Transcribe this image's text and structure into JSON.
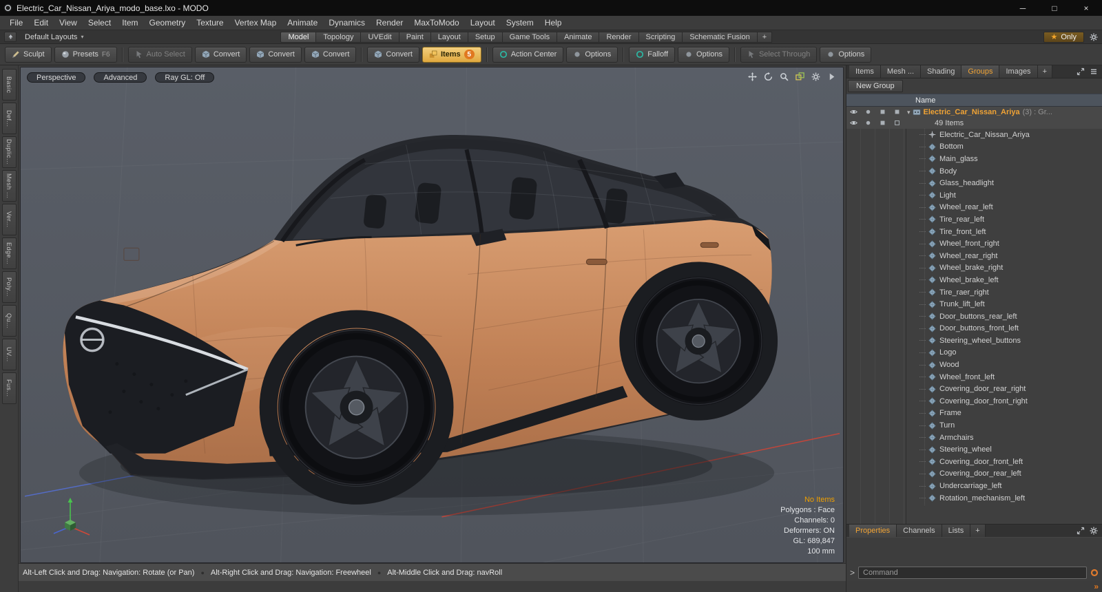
{
  "window": {
    "title": "Electric_Car_Nissan_Ariya_modo_base.lxo - MODO"
  },
  "icons": {
    "star": "★",
    "chevron-down": "▾",
    "bullet": "●",
    "prompt": ">",
    "double-chevron": "»",
    "close": "×",
    "minimize": "─",
    "maximize": "□"
  },
  "menu": {
    "items": [
      "File",
      "Edit",
      "View",
      "Select",
      "Item",
      "Geometry",
      "Texture",
      "Vertex Map",
      "Animate",
      "Dynamics",
      "Render",
      "MaxToModo",
      "Layout",
      "System",
      "Help"
    ]
  },
  "layout_bar": {
    "layouts_label": "Default Layouts",
    "tabs": [
      "Model",
      "Topology",
      "UVEdit",
      "Paint",
      "Layout",
      "Setup",
      "Game Tools",
      "Animate",
      "Render",
      "Scripting",
      "Schematic Fusion"
    ],
    "active_tab": "Model",
    "add_label": "+",
    "only_label": "Only"
  },
  "toolbar": {
    "buttons": [
      {
        "label": "Sculpt",
        "icon": "brush"
      },
      {
        "label": "Presets",
        "icon": "sphere",
        "shortcut": "F6"
      },
      {
        "label": "Auto Select",
        "icon": "cursor",
        "disabled": true,
        "sep": true
      },
      {
        "label": "Convert",
        "icon": "cube"
      },
      {
        "label": "Convert",
        "icon": "cube"
      },
      {
        "label": "Convert",
        "icon": "cube"
      },
      {
        "label": "Convert",
        "icon": "cube",
        "sep": true
      },
      {
        "label": "Items",
        "icon": "items",
        "badge": "5",
        "highlight": true
      },
      {
        "label": "Action Center",
        "icon": "ring",
        "sep": true
      },
      {
        "label": "Options",
        "icon": "dot"
      },
      {
        "label": "Falloff",
        "icon": "ring",
        "sep": true
      },
      {
        "label": "Options",
        "icon": "dot"
      },
      {
        "label": "Select Through",
        "icon": "cursor",
        "disabled": true,
        "sep": true
      },
      {
        "label": "Options",
        "icon": "dot"
      }
    ]
  },
  "left_tabs": [
    "Basic",
    "Def...",
    "Duplic...",
    "Mesh ...",
    "Ver...",
    "Edge...",
    "Poly...",
    "Qu...",
    "UV...",
    "Fus..."
  ],
  "viewport": {
    "controls": [
      "Perspective",
      "Advanced",
      "Ray GL: Off"
    ],
    "corner_icons": [
      "pan",
      "orbit",
      "magnifier",
      "snap",
      "gear",
      "arrow-right"
    ],
    "info_highlight": "No Items",
    "info_lines": [
      "Polygons : Face",
      "Channels: 0",
      "Deformers: ON",
      "GL: 689,847",
      "100 mm"
    ]
  },
  "right_panel": {
    "tabs": [
      "Items",
      "Mesh ...",
      "Shading",
      "Groups",
      "Images"
    ],
    "active_tab": "Groups",
    "add_label": "+",
    "new_group_label": "New Group",
    "name_header": "Name",
    "group": {
      "label": "Electric_Car_Nissan_Ariya",
      "suffix": "(3) : Gr...",
      "count": "49 Items"
    },
    "items": [
      {
        "label": "Electric_Car_Nissan_Ariya",
        "icon": "locator"
      },
      {
        "label": "Bottom",
        "icon": "gem"
      },
      {
        "label": "Main_glass",
        "icon": "gem"
      },
      {
        "label": "Body",
        "icon": "gem"
      },
      {
        "label": "Glass_headlight",
        "icon": "gem"
      },
      {
        "label": "Light",
        "icon": "gem"
      },
      {
        "label": "Wheel_rear_left",
        "icon": "gem"
      },
      {
        "label": "Tire_rear_left",
        "icon": "gem"
      },
      {
        "label": "Tire_front_left",
        "icon": "gem"
      },
      {
        "label": "Wheel_front_right",
        "icon": "gem"
      },
      {
        "label": "Wheel_rear_right",
        "icon": "gem"
      },
      {
        "label": "Wheel_brake_right",
        "icon": "gem"
      },
      {
        "label": "Wheel_brake_left",
        "icon": "gem"
      },
      {
        "label": "Tire_raer_right",
        "icon": "gem"
      },
      {
        "label": "Trunk_lift_left",
        "icon": "gem"
      },
      {
        "label": "Door_buttons_rear_left",
        "icon": "gem"
      },
      {
        "label": "Door_buttons_front_left",
        "icon": "gem"
      },
      {
        "label": "Steering_wheel_buttons",
        "icon": "gem"
      },
      {
        "label": "Logo",
        "icon": "gem"
      },
      {
        "label": "Wood",
        "icon": "gem"
      },
      {
        "label": "Wheel_front_left",
        "icon": "gem"
      },
      {
        "label": "Covering_door_rear_right",
        "icon": "gem"
      },
      {
        "label": "Covering_door_front_right",
        "icon": "gem"
      },
      {
        "label": "Frame",
        "icon": "gem"
      },
      {
        "label": "Turn",
        "icon": "gem"
      },
      {
        "label": "Armchairs",
        "icon": "gem"
      },
      {
        "label": "Steering_wheel",
        "icon": "gem"
      },
      {
        "label": "Covering_door_front_left",
        "icon": "gem"
      },
      {
        "label": "Covering_door_rear_left",
        "icon": "gem"
      },
      {
        "label": "Undercarriage_left",
        "icon": "gem"
      },
      {
        "label": "Rotation_mechanism_left",
        "icon": "gem"
      }
    ],
    "bottom_tabs": [
      "Properties",
      "Channels",
      "Lists"
    ],
    "active_bottom_tab": "Properties",
    "command_placeholder": "Command"
  },
  "status_bar": {
    "segments": [
      "Alt-Left Click and Drag: Navigation: Rotate (or Pan)",
      "Alt-Right Click and Drag: Navigation: Freewheel",
      "Alt-Middle Click and Drag: navRoll"
    ]
  },
  "colors": {
    "accent_orange": "#f0a335",
    "car_body": "#c58663",
    "viewport_bg": "#565b63",
    "badge_orange": "#e07820"
  }
}
